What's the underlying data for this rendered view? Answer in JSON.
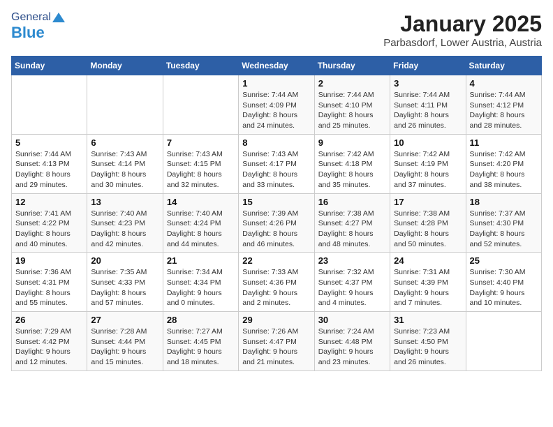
{
  "header": {
    "logo_general": "General",
    "logo_blue": "Blue",
    "title": "January 2025",
    "subtitle": "Parbasdorf, Lower Austria, Austria"
  },
  "days_of_week": [
    "Sunday",
    "Monday",
    "Tuesday",
    "Wednesday",
    "Thursday",
    "Friday",
    "Saturday"
  ],
  "weeks": [
    [
      {
        "day": "",
        "info": ""
      },
      {
        "day": "",
        "info": ""
      },
      {
        "day": "",
        "info": ""
      },
      {
        "day": "1",
        "info": "Sunrise: 7:44 AM\nSunset: 4:09 PM\nDaylight: 8 hours and 24 minutes."
      },
      {
        "day": "2",
        "info": "Sunrise: 7:44 AM\nSunset: 4:10 PM\nDaylight: 8 hours and 25 minutes."
      },
      {
        "day": "3",
        "info": "Sunrise: 7:44 AM\nSunset: 4:11 PM\nDaylight: 8 hours and 26 minutes."
      },
      {
        "day": "4",
        "info": "Sunrise: 7:44 AM\nSunset: 4:12 PM\nDaylight: 8 hours and 28 minutes."
      }
    ],
    [
      {
        "day": "5",
        "info": "Sunrise: 7:44 AM\nSunset: 4:13 PM\nDaylight: 8 hours and 29 minutes."
      },
      {
        "day": "6",
        "info": "Sunrise: 7:43 AM\nSunset: 4:14 PM\nDaylight: 8 hours and 30 minutes."
      },
      {
        "day": "7",
        "info": "Sunrise: 7:43 AM\nSunset: 4:15 PM\nDaylight: 8 hours and 32 minutes."
      },
      {
        "day": "8",
        "info": "Sunrise: 7:43 AM\nSunset: 4:17 PM\nDaylight: 8 hours and 33 minutes."
      },
      {
        "day": "9",
        "info": "Sunrise: 7:42 AM\nSunset: 4:18 PM\nDaylight: 8 hours and 35 minutes."
      },
      {
        "day": "10",
        "info": "Sunrise: 7:42 AM\nSunset: 4:19 PM\nDaylight: 8 hours and 37 minutes."
      },
      {
        "day": "11",
        "info": "Sunrise: 7:42 AM\nSunset: 4:20 PM\nDaylight: 8 hours and 38 minutes."
      }
    ],
    [
      {
        "day": "12",
        "info": "Sunrise: 7:41 AM\nSunset: 4:22 PM\nDaylight: 8 hours and 40 minutes."
      },
      {
        "day": "13",
        "info": "Sunrise: 7:40 AM\nSunset: 4:23 PM\nDaylight: 8 hours and 42 minutes."
      },
      {
        "day": "14",
        "info": "Sunrise: 7:40 AM\nSunset: 4:24 PM\nDaylight: 8 hours and 44 minutes."
      },
      {
        "day": "15",
        "info": "Sunrise: 7:39 AM\nSunset: 4:26 PM\nDaylight: 8 hours and 46 minutes."
      },
      {
        "day": "16",
        "info": "Sunrise: 7:38 AM\nSunset: 4:27 PM\nDaylight: 8 hours and 48 minutes."
      },
      {
        "day": "17",
        "info": "Sunrise: 7:38 AM\nSunset: 4:28 PM\nDaylight: 8 hours and 50 minutes."
      },
      {
        "day": "18",
        "info": "Sunrise: 7:37 AM\nSunset: 4:30 PM\nDaylight: 8 hours and 52 minutes."
      }
    ],
    [
      {
        "day": "19",
        "info": "Sunrise: 7:36 AM\nSunset: 4:31 PM\nDaylight: 8 hours and 55 minutes."
      },
      {
        "day": "20",
        "info": "Sunrise: 7:35 AM\nSunset: 4:33 PM\nDaylight: 8 hours and 57 minutes."
      },
      {
        "day": "21",
        "info": "Sunrise: 7:34 AM\nSunset: 4:34 PM\nDaylight: 9 hours and 0 minutes."
      },
      {
        "day": "22",
        "info": "Sunrise: 7:33 AM\nSunset: 4:36 PM\nDaylight: 9 hours and 2 minutes."
      },
      {
        "day": "23",
        "info": "Sunrise: 7:32 AM\nSunset: 4:37 PM\nDaylight: 9 hours and 4 minutes."
      },
      {
        "day": "24",
        "info": "Sunrise: 7:31 AM\nSunset: 4:39 PM\nDaylight: 9 hours and 7 minutes."
      },
      {
        "day": "25",
        "info": "Sunrise: 7:30 AM\nSunset: 4:40 PM\nDaylight: 9 hours and 10 minutes."
      }
    ],
    [
      {
        "day": "26",
        "info": "Sunrise: 7:29 AM\nSunset: 4:42 PM\nDaylight: 9 hours and 12 minutes."
      },
      {
        "day": "27",
        "info": "Sunrise: 7:28 AM\nSunset: 4:44 PM\nDaylight: 9 hours and 15 minutes."
      },
      {
        "day": "28",
        "info": "Sunrise: 7:27 AM\nSunset: 4:45 PM\nDaylight: 9 hours and 18 minutes."
      },
      {
        "day": "29",
        "info": "Sunrise: 7:26 AM\nSunset: 4:47 PM\nDaylight: 9 hours and 21 minutes."
      },
      {
        "day": "30",
        "info": "Sunrise: 7:24 AM\nSunset: 4:48 PM\nDaylight: 9 hours and 23 minutes."
      },
      {
        "day": "31",
        "info": "Sunrise: 7:23 AM\nSunset: 4:50 PM\nDaylight: 9 hours and 26 minutes."
      },
      {
        "day": "",
        "info": ""
      }
    ]
  ]
}
